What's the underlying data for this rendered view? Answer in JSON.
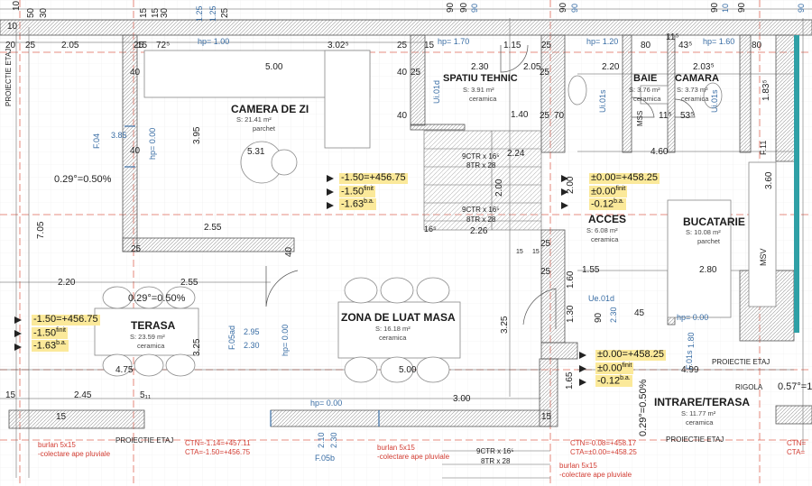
{
  "rooms": [
    {
      "id": "camera",
      "name": "CAMERA DE ZI",
      "area": "S: 21.41 m²",
      "finish": "parchet"
    },
    {
      "id": "spatiu",
      "name": "SPATIU TEHNIC",
      "area": "S: 3.91 m²",
      "finish": "ceramica"
    },
    {
      "id": "baie",
      "name": "BAIE",
      "area": "S: 3.76 m²",
      "finish": "ceramica"
    },
    {
      "id": "camara",
      "name": "CAMARA",
      "area": "S: 3.73 m²",
      "finish": "ceramica"
    },
    {
      "id": "acces",
      "name": "ACCES",
      "area": "S: 6.08 m²",
      "finish": "ceramica"
    },
    {
      "id": "bucatarie",
      "name": "BUCATARIE",
      "area": "S: 10.08 m²",
      "finish": "parchet"
    },
    {
      "id": "terasa",
      "name": "TERASA",
      "area": "S: 23.59 m²",
      "finish": "ceramica"
    },
    {
      "id": "masa",
      "name": "ZONA DE LUAT MASA",
      "area": "S: 16.18 m²",
      "finish": "ceramica"
    },
    {
      "id": "intrare",
      "name": "INTRARE/TERASA",
      "area": "S: 11.77 m²",
      "finish": "ceramica"
    }
  ],
  "levels": {
    "center": [
      "-1.50=+456.75",
      "-1.50",
      "-1.63"
    ],
    "left": [
      "-1.50=+456.75",
      "-1.50",
      "-1.63"
    ],
    "right_top": [
      "±0.00=+458.25",
      "±0.00",
      "-0.12"
    ],
    "right_bottom": [
      "±0.00=+458.25",
      "±0.00",
      "-0.12"
    ],
    "sup_finit": "finit",
    "sup_ba": "b.a."
  },
  "slopes": {
    "a": "0.29°=0.50%",
    "b": "0.29°=0.50%",
    "c": "0.29°=0.50%",
    "d": "0.57°=1"
  },
  "stairs": {
    "s1a": "9CTR x 16⁵",
    "s1b": "8TR x 28",
    "s2a": "9CTR x 16⁵",
    "s2b": "8TR x 28",
    "s3a": "9CTR x 16⁵",
    "s3b": "8TR x 28"
  },
  "labels": {
    "proiectie": "PROIECTIE ETAJ",
    "rigola": "RIGOLA",
    "burlan1": "burlan 5x15",
    "burlan2": "-colectare ape pluviale",
    "ctn1": "CTN=-1.14=+457.11",
    "cta1": "CTA=-1.50=+456.75",
    "ctn2": "CTN=-0.08=+458.17",
    "cta2": "CTA=±0.00=+458.25",
    "ctn3": "CTN=",
    "cta3": "CTA=",
    "msv": "MSV",
    "hp100": "hp= 1.00",
    "hp170": "hp= 1.70",
    "hp120": "hp= 1.20",
    "hp160": "hp= 1.60",
    "hp000": "hp= 0.00",
    "f04": "F.04",
    "f05ad": "F.05ad",
    "f05b": "F.05b",
    "f01s": "F.01s",
    "f11": "F.11",
    "ui01d": "Ui.01d",
    "ui01s": "Ui.01s",
    "ue01d": "Ue.01d",
    "mss": "MSS"
  },
  "dims": {
    "top": [
      "10",
      "50",
      "30",
      "15",
      "15",
      "30",
      "1.25",
      "1.25",
      "25",
      "90",
      "90",
      "90",
      "90",
      "90",
      "90",
      "10",
      "90",
      "90",
      "90",
      "90",
      "1"
    ],
    "row2": [
      "20",
      "10",
      "25",
      "15",
      "72⁵",
      "2.05",
      "25",
      "3.02⁵",
      "25",
      "15",
      "1.15",
      "25",
      "80",
      "43⁵",
      "80",
      "11⁵"
    ],
    "misc": [
      "5.00",
      "5.00",
      "2.30",
      "2.05",
      "2.20",
      "2.03⁵",
      "1.40",
      "1.83⁵",
      "3.85",
      "3.95",
      "5.31",
      "0.00",
      "7.05",
      "2.55",
      "2.24",
      "2.00",
      "2.26",
      "16⁵",
      "15",
      "15",
      "4.60",
      "3.60",
      "2.00",
      "2.80",
      "1.55",
      "2.55",
      "2.20",
      "1.60",
      "1.30",
      "25",
      "3.25",
      "3.25",
      "2.95",
      "2.30",
      "4.75",
      "5.00",
      "2.45",
      "5₁₁",
      "3.00",
      "4.99",
      "1.65",
      "1.80",
      "2.30",
      "45",
      "90",
      "2.10",
      "2.30",
      "1.00",
      "40",
      "40",
      "40",
      "40",
      "40",
      "25",
      "25",
      "25",
      "25",
      "25",
      "15",
      "15",
      "15",
      "70",
      "11⁵",
      "53⁵",
      "30"
    ]
  }
}
